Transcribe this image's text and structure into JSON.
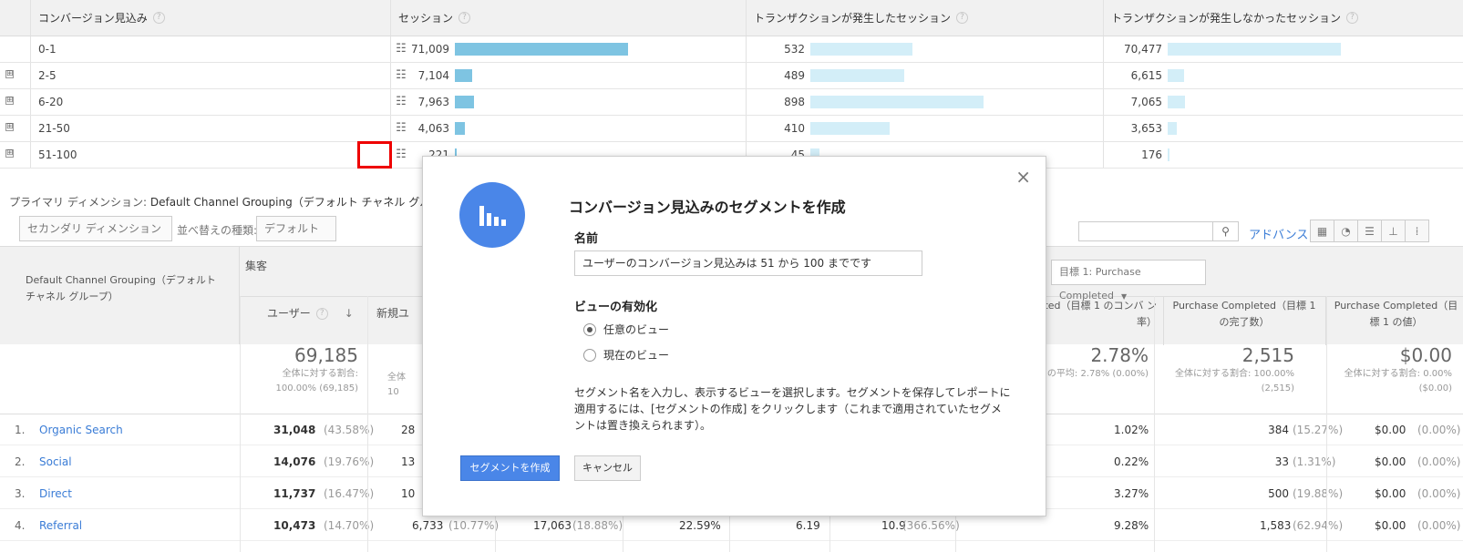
{
  "top_table": {
    "headers": [
      "コンバージョン見込み",
      "セッション",
      "トランザクションが発生したセッション",
      "トランザクションが発生しなかったセッション"
    ],
    "help": "?",
    "expand": "⊞",
    "rows": [
      {
        "label": "0-1",
        "sessions": "71,009",
        "with_tx": "532",
        "without_tx": "70,477",
        "s_frac": 1.0,
        "t_frac": 0.59,
        "n_frac": 1.0
      },
      {
        "label": "2-5",
        "sessions": "7,104",
        "with_tx": "489",
        "without_tx": "6,615",
        "s_frac": 0.1,
        "t_frac": 0.54,
        "n_frac": 0.094
      },
      {
        "label": "6-20",
        "sessions": "7,963",
        "with_tx": "898",
        "without_tx": "7,065",
        "s_frac": 0.11,
        "t_frac": 1.0,
        "n_frac": 0.1
      },
      {
        "label": "21-50",
        "sessions": "4,063",
        "with_tx": "410",
        "without_tx": "3,653",
        "s_frac": 0.057,
        "t_frac": 0.46,
        "n_frac": 0.052
      },
      {
        "label": "51-100",
        "sessions": "221",
        "with_tx": "45",
        "without_tx": "176",
        "s_frac": 0.003,
        "t_frac": 0.05,
        "n_frac": 0.0025
      }
    ]
  },
  "primary_dim": {
    "label": "プライマリ ディメンション:",
    "value": "Default Channel Grouping（デフォルト チャネル グループ）"
  },
  "controls": {
    "secondary": "セカンダリ ディメンション",
    "sort_label": "並べ替えの種類:",
    "sort_value": "デフォルト",
    "advanced": "アドバンス",
    "goal_select": "目標 1: Purchase Completed"
  },
  "bottom_table": {
    "dim_header": "Default Channel Grouping（デフォルト チャネル グループ）",
    "group": "集客",
    "col_users": "ユーザー",
    "col_new": "新規ユ",
    "col_cr": "ted（目標 1 のコンバ ン率）",
    "col_comp": "Purchase Completed（目標 1 の完了数）",
    "col_val": "Purchase Completed（目標 1 の値）",
    "tot_users": "69,185",
    "tot_users_sub1": "全体に対する割合:",
    "tot_users_sub2": "100.00% (69,185)",
    "tot_new_sub1": "全体",
    "tot_new_sub2": "10",
    "tot_cr": "2.78%",
    "tot_cr_sub": "の平均: 2.78% (0.00%)",
    "tot_comp": "2,515",
    "tot_comp_sub1": "全体に対する割合: 100.00%",
    "tot_comp_sub2": "(2,515)",
    "tot_val": "$0.00",
    "tot_val_sub1": "全体に対する割合: 0.00%",
    "tot_val_sub2": "($0.00)",
    "rows": [
      {
        "n": "1.",
        "name": "Organic Search",
        "users": "31,048",
        "up": "(43.58%)",
        "nu": "28",
        "cr": "1.02%",
        "comp": "384",
        "cp": "(15.27%)",
        "val": "$0.00",
        "vp": "(0.00%)"
      },
      {
        "n": "2.",
        "name": "Social",
        "users": "14,076",
        "up": "(19.76%)",
        "nu": "13",
        "cr": "0.22%",
        "comp": "33",
        "cp": "(1.31%)",
        "val": "$0.00",
        "vp": "(0.00%)"
      },
      {
        "n": "3.",
        "name": "Direct",
        "users": "11,737",
        "up": "(16.47%)",
        "nu": "10",
        "cr": "3.27%",
        "comp": "500",
        "cp": "(19.88%)",
        "val": "$0.00",
        "vp": "(0.00%)"
      },
      {
        "n": "4.",
        "name": "Referral",
        "users": "10,473",
        "up": "(14.70%)",
        "nu": "6,733",
        "nup": "(10.77%)",
        "ses": "17,063",
        "sesp": "(18.88%)",
        "br": "22.59%",
        "pps": "6.19",
        "dur": "10.9",
        "durp": "(366.56%)",
        "cr": "9.28%",
        "comp": "1,583",
        "cp": "(62.94%)",
        "val": "$0.00",
        "vp": "(0.00%)"
      }
    ]
  },
  "modal": {
    "title": "コンバージョン見込みのセグメントを作成",
    "name_label": "名前",
    "name_value": "ユーザーのコンバージョン見込みは 51 から 100 までです",
    "view_label": "ビューの有効化",
    "opt_any": "任意のビュー",
    "opt_current": "現在のビュー",
    "description": "セグメント名を入力し、表示するビューを選択します。セグメントを保存してレポートに適用するには、[セグメントの作成] をクリックします（これまで適用されていたセグメントは置き換えられます）。",
    "create": "セグメントを作成",
    "cancel": "キャンセル",
    "close": "×"
  }
}
